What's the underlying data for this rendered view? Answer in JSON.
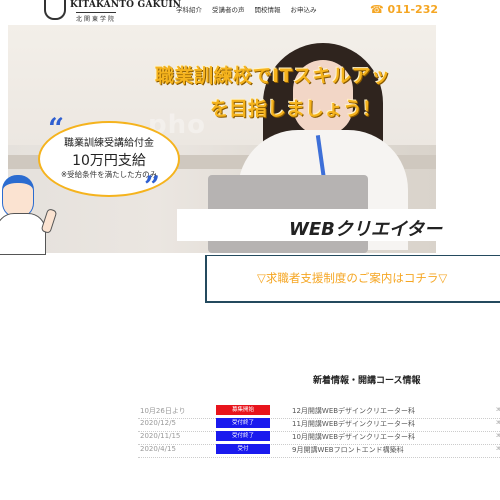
{
  "header": {
    "logo_en": "KITAKANTO GAKUIN",
    "logo_jp": "北関東学院",
    "nav": [
      "学科紹介",
      "受講者の声",
      "開校情報",
      "お申込み"
    ],
    "phone": "☎ 011-232"
  },
  "hero": {
    "heading_line1": "職業訓練校でITスキルアッ",
    "heading_line2": "を目指しましょう！",
    "course_label": "WEBクリエイター",
    "watermark": "pho"
  },
  "subsidy": {
    "line1": "職業訓練受講給付金",
    "line2": "10万円支給",
    "line3": "※受給条件を満たした方のみ"
  },
  "support_link": "▽求職者支援制度のご案内はコチラ▽",
  "news": {
    "title": "新着情報・開講コース情報",
    "items": [
      {
        "date": "10月26日より",
        "badge": "募集開始",
        "badge_color": "#e8141c",
        "text": "12月開講WEBデザインクリエーター科"
      },
      {
        "date": "2020/12/5",
        "badge": "受付終了",
        "badge_color": "#1a1aee",
        "text": "11月開講WEBデザインクリエーター科"
      },
      {
        "date": "2020/11/15",
        "badge": "受付終了",
        "badge_color": "#1a1aee",
        "text": "10月開講WEBデザインクリエーター科"
      },
      {
        "date": "2020/4/15",
        "badge": "受付",
        "badge_color": "#1a1aee",
        "text": "9月開講WEBフロントエンド構築科"
      }
    ],
    "row_tail": "≫"
  }
}
